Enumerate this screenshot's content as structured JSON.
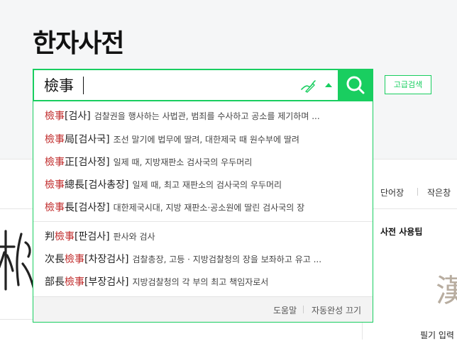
{
  "page": {
    "title": "한자사전"
  },
  "search": {
    "query": "檢事",
    "advanced_label": "고급검색"
  },
  "suggestions": [
    {
      "pre": "",
      "hl": "檢事",
      "post": "",
      "reading": "[검사]",
      "desc": "검찰권을 행사하는 사법관, 범죄를 수사하고 공소를 제기하며 ..."
    },
    {
      "pre": "",
      "hl": "檢事",
      "post": "局",
      "reading": "[검사국]",
      "desc": "조선 말기에 법무에 딸려, 대한제국 때 원수부에 딸려"
    },
    {
      "pre": "",
      "hl": "檢事",
      "post": "正",
      "reading": "[검사정]",
      "desc": "일제 때, 지방재판소 검사국의 우두머리"
    },
    {
      "pre": "",
      "hl": "檢事",
      "post": "總長",
      "reading": "[검사총장]",
      "desc": "일제 때, 최고 재판소의 검사국의 우두머리"
    },
    {
      "pre": "",
      "hl": "檢事",
      "post": "長",
      "reading": "[검사장]",
      "desc": "대한제국시대, 지방 재판소·공소원에 딸린 검사국의 장"
    },
    {
      "pre": "判",
      "hl": "檢事",
      "post": "",
      "reading": "[판검사]",
      "desc": "판사와 검사"
    },
    {
      "pre": "次長",
      "hl": "檢事",
      "post": "",
      "reading": "[차장검사]",
      "desc": "검찰총장, 고등 · 지방검찰청의 장을 보좌하고 유고 ..."
    },
    {
      "pre": "部長",
      "hl": "檢事",
      "post": "",
      "reading": "[부장검사]",
      "desc": "지방검찰청의 각 부의 최고 책임자로서"
    }
  ],
  "dropdown_footer": {
    "help": "도움말",
    "autocomplete_off": "자동완성 끄기"
  },
  "right_panel": {
    "tab_vocab": "단어장",
    "tab_small": "작은창",
    "tips_title": "사전 사용팁",
    "big_char": "漢",
    "bottom_text": "필기 입력"
  },
  "colors": {
    "accent": "#19ce60",
    "highlight": "#c02a2a"
  },
  "icons": [
    "handwriting-icon",
    "arrow-up-icon",
    "search-icon"
  ]
}
